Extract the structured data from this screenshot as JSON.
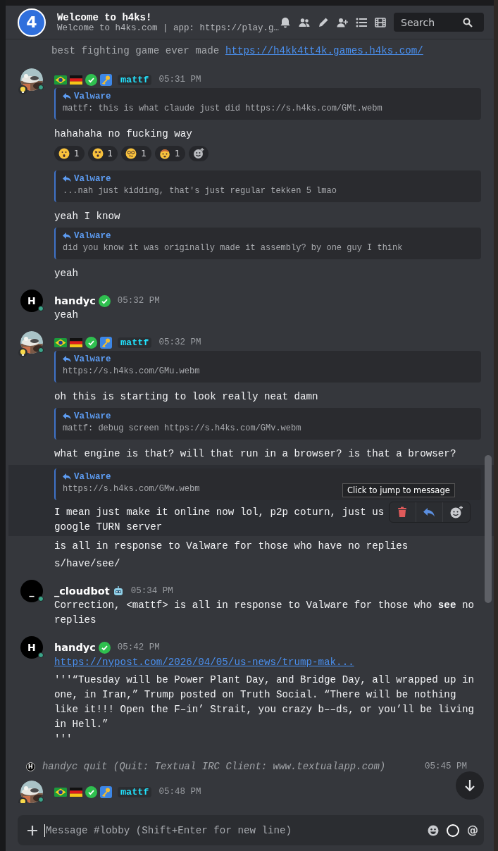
{
  "header": {
    "channel_number": "4",
    "title": "Welcome to h4ks!",
    "topic": "Welcome to h4ks.com | app: https://play.g…",
    "search": {
      "placeholder": "Search"
    }
  },
  "messages": [
    {
      "kind": "continuation",
      "text": "best fighting game ever made ",
      "link": "https://h4kk4tt4k.games.h4ks.com/"
    },
    {
      "kind": "staff_message",
      "author": "mattf",
      "online": true,
      "time": "05:31 PM",
      "items": [
        {
          "kind": "reply",
          "author": "Valware",
          "text": "mattf: this is what claude just did https://s.h4ks.com/GMt.webm",
          "hovered": false
        },
        {
          "kind": "text",
          "text": "hahahaha no fucking way",
          "hovered": false
        },
        {
          "kind": "reactions",
          "reactions": [
            {
              "count": "1"
            },
            {
              "count": "1"
            },
            {
              "count": "1"
            },
            {
              "count": "1"
            }
          ]
        },
        {
          "kind": "reply",
          "author": "Valware",
          "text": "...nah just kidding, that's just regular tekken 5 lmao",
          "hovered": false
        },
        {
          "kind": "text",
          "text": "yeah I know",
          "hovered": false
        },
        {
          "kind": "reply",
          "author": "Valware",
          "text": "did you know it was originally made it assembly? by one guy I think",
          "hovered": false
        },
        {
          "kind": "text",
          "text": "yeah",
          "hovered": false
        }
      ]
    },
    {
      "kind": "user_message",
      "author": "handyc",
      "avatar_letter": "H",
      "online": true,
      "time": "05:32 PM",
      "items": [
        {
          "kind": "text",
          "text": "yeah",
          "hovered": false
        }
      ]
    },
    {
      "kind": "staff_message",
      "author": "mattf",
      "online": true,
      "time": "05:32 PM",
      "items": [
        {
          "kind": "reply",
          "author": "Valware",
          "text": "https://s.h4ks.com/GMu.webm",
          "hovered": false
        },
        {
          "kind": "text",
          "text": "oh this is starting to look really neat damn",
          "hovered": false
        },
        {
          "kind": "reply",
          "author": "Valware",
          "text": "mattf: debug screen https://s.h4ks.com/GMv.webm",
          "hovered": false
        },
        {
          "kind": "text",
          "text": "what engine is that? will that run in a browser? is that a browser?",
          "hovered": false
        },
        {
          "kind": "reply",
          "author": "Valware",
          "text": "https://s.h4ks.com/GMw.webm",
          "hovered": true
        },
        {
          "kind": "text",
          "text": "I mean just make it online now lol, p2p coturn, just us\ngoogle TURN server",
          "hovered": true,
          "tooltip": "Click to jump to message",
          "show_actions": true
        },
        {
          "kind": "text",
          "text": "is all in response to Valware for those who have no replies",
          "hovered": false
        },
        {
          "kind": "text",
          "text": "s/have/see/",
          "hovered": false
        }
      ]
    },
    {
      "kind": "bot_message",
      "author": "_cloudbot",
      "avatar_letter": "_",
      "online": true,
      "time": "05:34 PM",
      "items": [
        {
          "kind": "text",
          "text": "Correction, <mattf> is all in response to Valware for those who **see** no replies",
          "hovered": false
        }
      ]
    },
    {
      "kind": "user_message",
      "author": "handyc",
      "avatar_letter": "H",
      "online": true,
      "time": "05:42 PM",
      "items": [
        {
          "kind": "link",
          "text": "https://nypost.com/2026/04/05/us-news/trump-mak..."
        },
        {
          "kind": "text",
          "text": "'''“Tuesday will be Power Plant Day, and Bridge Day, all wrapped up in one, in Iran,” Trump posted on Truth Social. “There will be nothing like it!!! Open the F–in’ Strait, you crazy b––ds, or you’ll be living in Hell.”\n'''",
          "hovered": false
        }
      ]
    },
    {
      "kind": "system",
      "avatar_letter": "H",
      "text": "handyc quit (Quit: Textual IRC Client: www.textualapp.com)",
      "time": "05:45 PM"
    },
    {
      "kind": "staff_message",
      "author": "mattf",
      "online": true,
      "time": "05:48 PM"
    }
  ],
  "composer": {
    "placeholder": "Message #lobby (Shift+Enter for new line)",
    "mention": "@"
  }
}
